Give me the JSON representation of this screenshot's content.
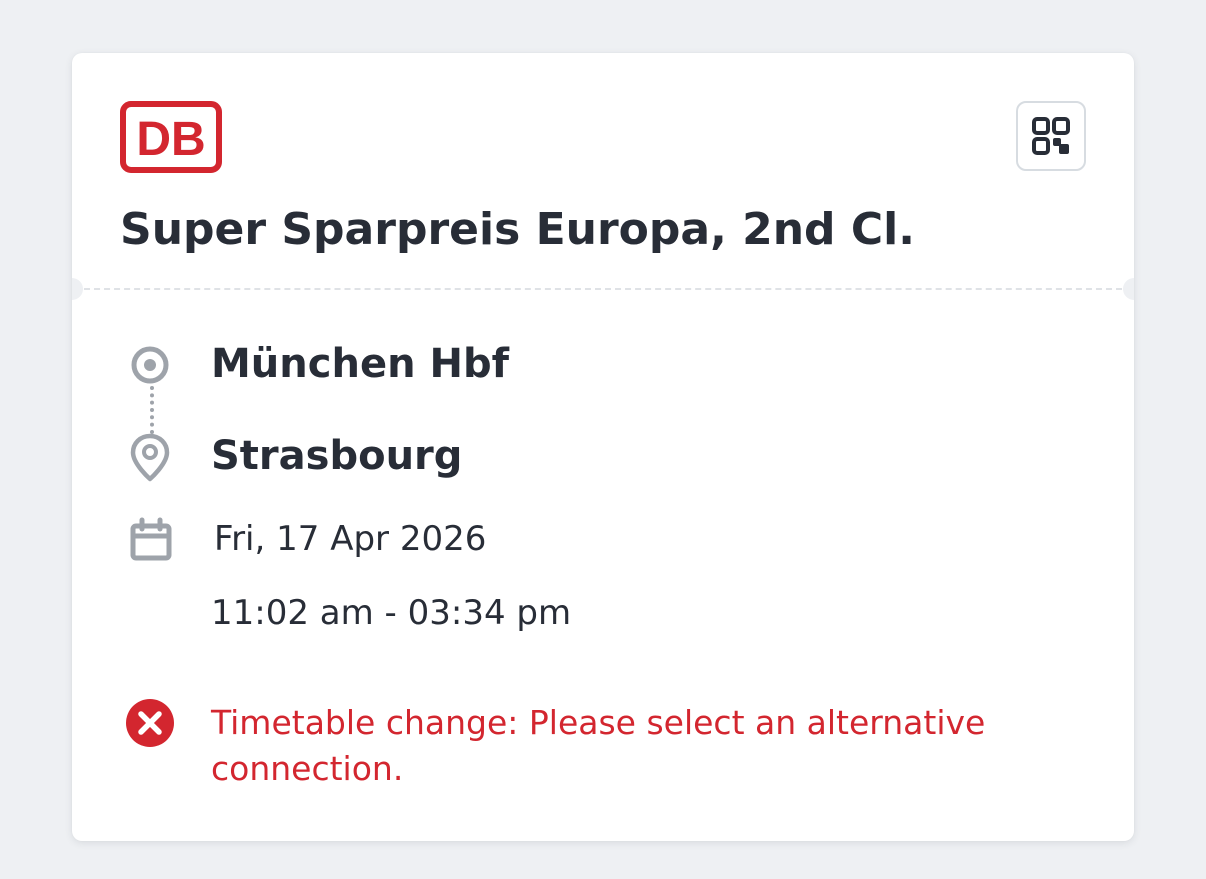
{
  "brand": {
    "logo_text": "DB",
    "logo_icon": "db-logo",
    "color": "#ec0016"
  },
  "toolbar": {
    "qr_icon": "qr-code-icon"
  },
  "ticket": {
    "title": "Super Sparpreis Europa, 2nd Cl.",
    "origin": "München Hbf",
    "destination": "Strasbourg",
    "date": "Fri, 17 Apr 2026",
    "time": "11:02 am - 03:34 pm"
  },
  "alert": {
    "icon": "error-circle-icon",
    "message": "Timetable change: Please select an alternative connection.",
    "color": "#d3262f"
  },
  "colors": {
    "text": "#282d37",
    "icon_grey": "#9ea3aa",
    "background": "#eef0f3",
    "card": "#ffffff"
  }
}
